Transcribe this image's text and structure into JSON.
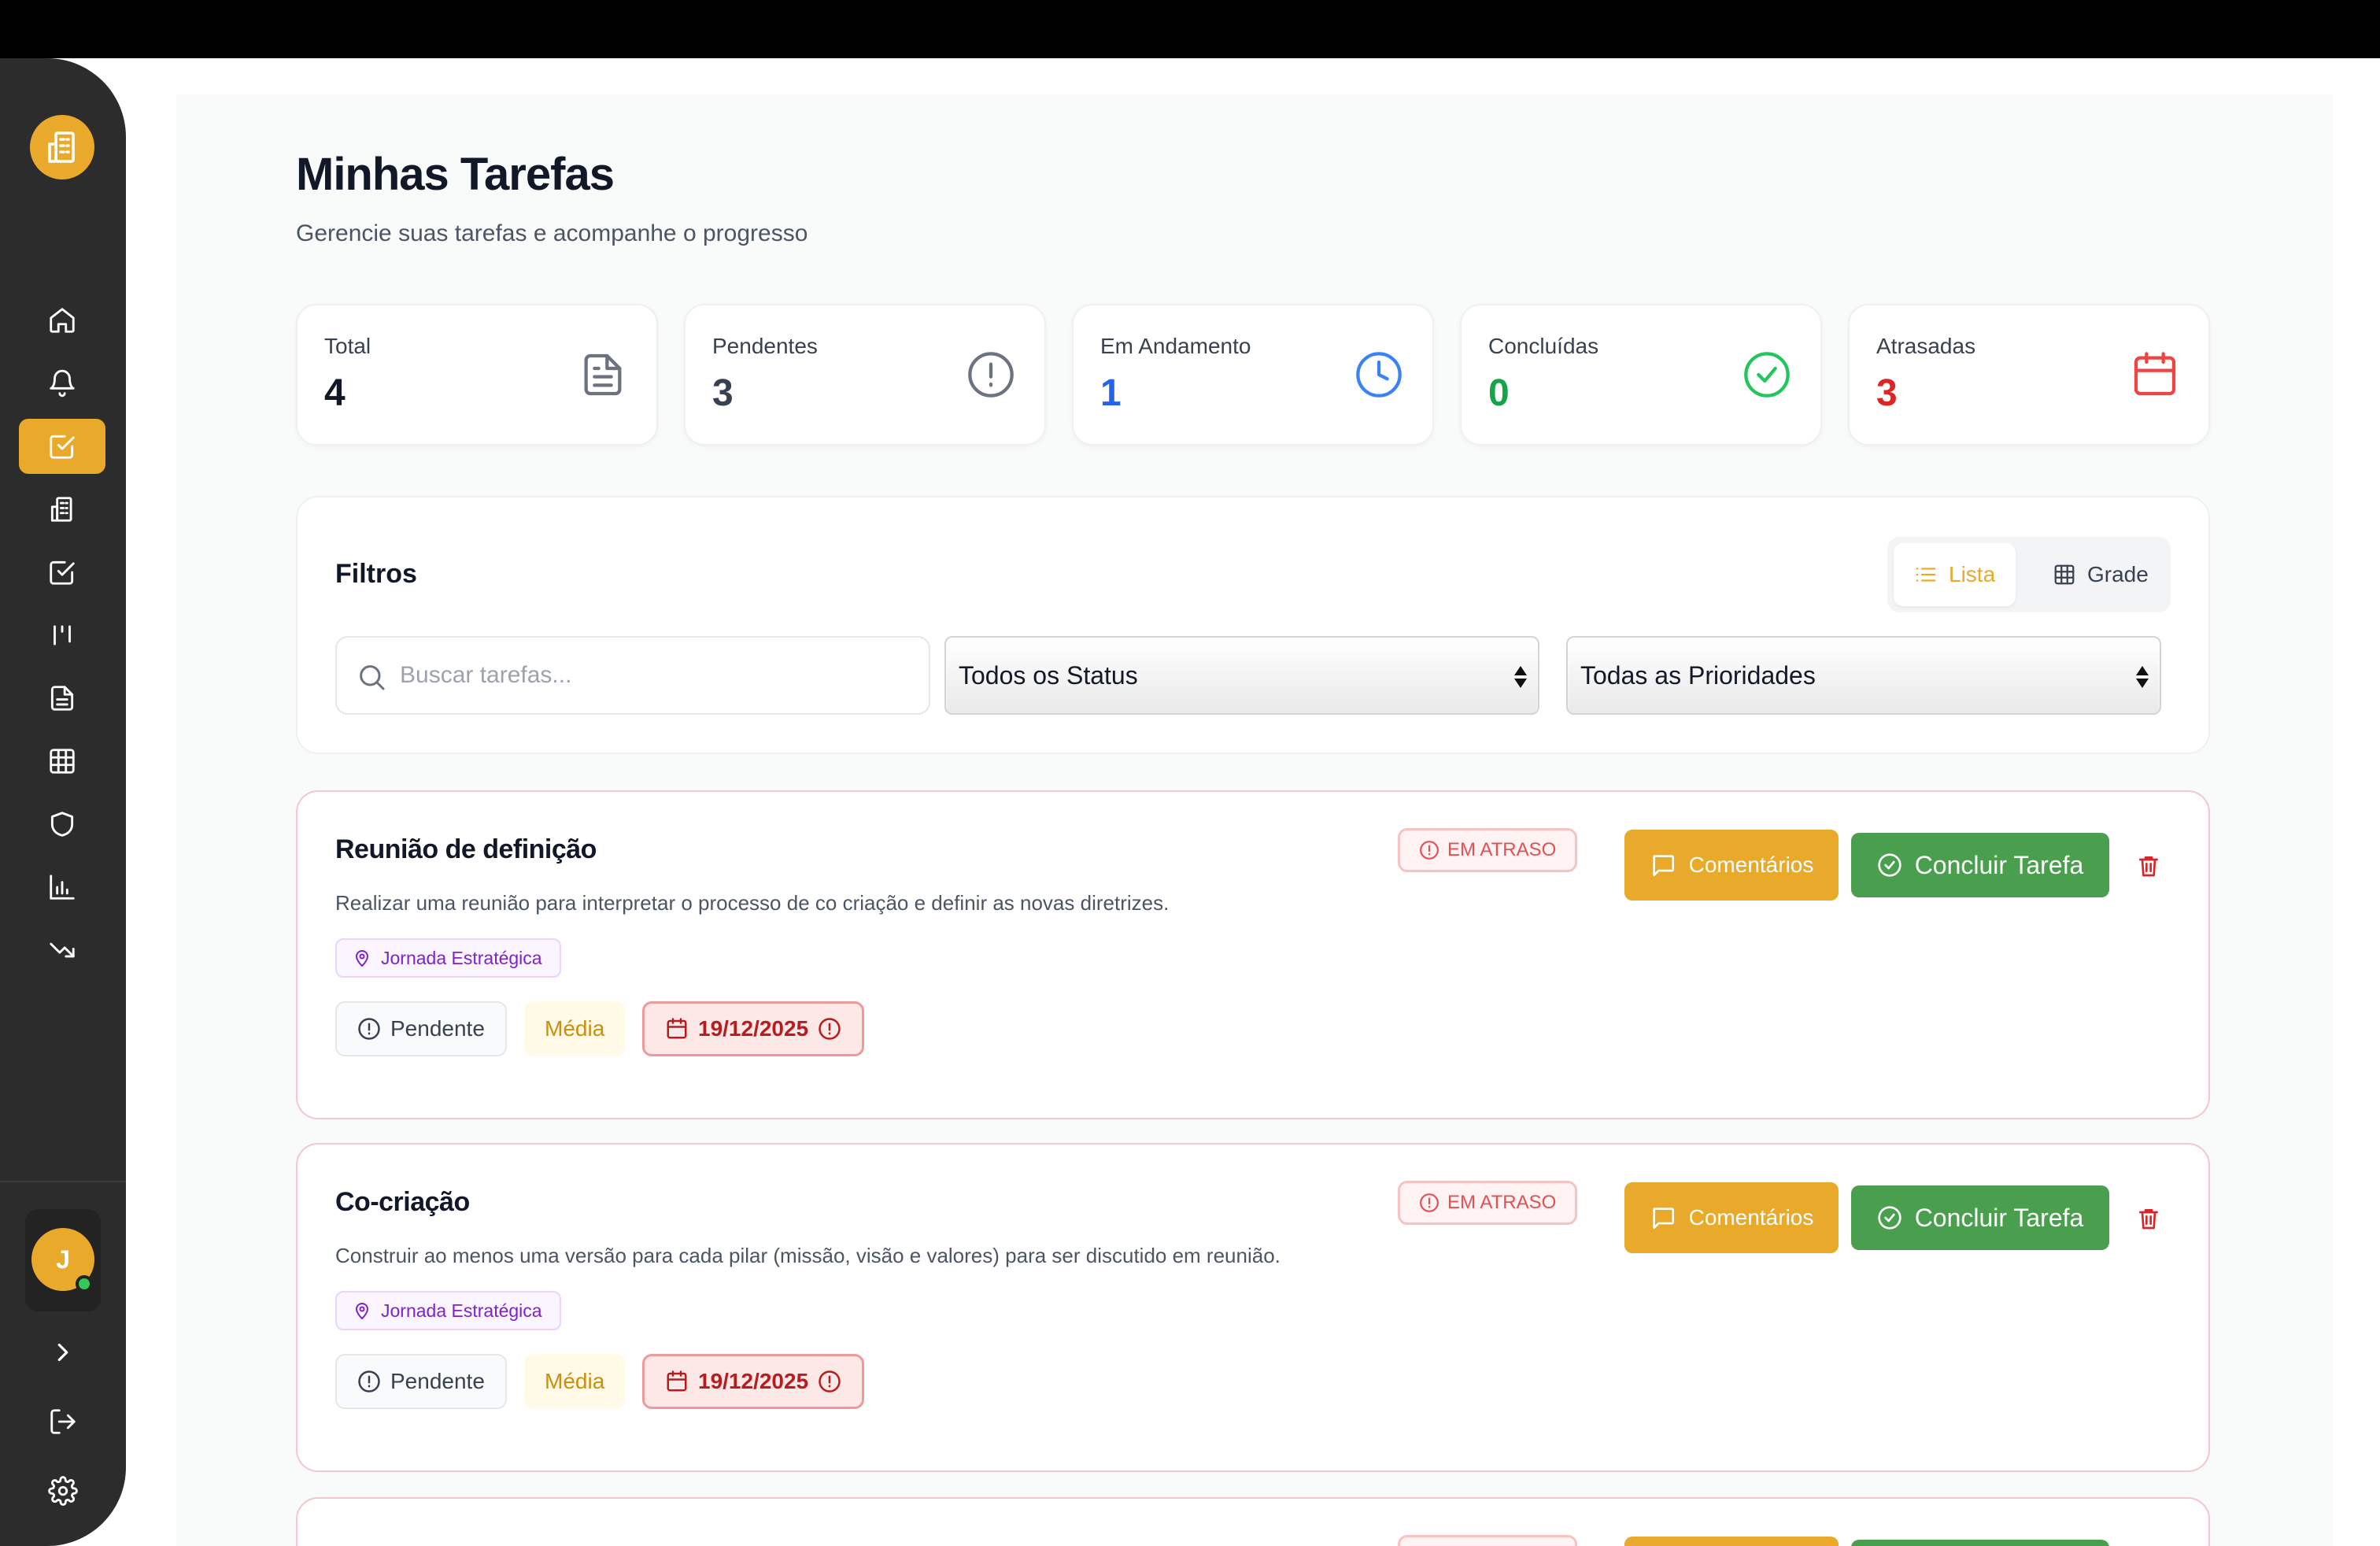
{
  "header": {
    "title": "Minhas Tarefas",
    "subtitle": "Gerencie suas tarefas e acompanhe o progresso"
  },
  "sidebar": {
    "items": [
      {
        "icon": "home-icon"
      },
      {
        "icon": "bell-icon"
      },
      {
        "icon": "task-check-icon",
        "active": true
      },
      {
        "icon": "building-icon"
      },
      {
        "icon": "checkbox-icon"
      },
      {
        "icon": "columns-icon"
      },
      {
        "icon": "document-icon"
      },
      {
        "icon": "grid-icon"
      },
      {
        "icon": "shield-icon"
      },
      {
        "icon": "bar-chart-icon"
      },
      {
        "icon": "trending-down-icon"
      }
    ],
    "user_initial": "J"
  },
  "stats": [
    {
      "label": "Total",
      "value": "4",
      "color": "#111827",
      "icon": "document-icon"
    },
    {
      "label": "Pendentes",
      "value": "3",
      "color": "#374151",
      "icon": "alert-circle-icon"
    },
    {
      "label": "Em Andamento",
      "value": "1",
      "color": "#2563eb",
      "icon": "clock-icon"
    },
    {
      "label": "Concluídas",
      "value": "0",
      "color": "#16a34a",
      "icon": "check-circle-icon"
    },
    {
      "label": "Atrasadas",
      "value": "3",
      "color": "#dc2626",
      "icon": "calendar-icon"
    }
  ],
  "filters": {
    "title": "Filtros",
    "view_list": "Lista",
    "view_grid": "Grade",
    "search_placeholder": "Buscar tarefas...",
    "status_selected": "Todos os Status",
    "priority_selected": "Todas as Prioridades"
  },
  "tasks": [
    {
      "title": "Reunião de definição",
      "description": "Realizar uma reunião para interpretar o processo de co criação e definir as novas diretrizes.",
      "project": "Jornada Estratégica",
      "status": "Pendente",
      "priority": "Média",
      "due_date": "19/12/2025",
      "badge": "EM ATRASO",
      "comments_label": "Comentários",
      "complete_label": "Concluir Tarefa"
    },
    {
      "title": "Co-criação",
      "description": "Construir ao menos uma versão para cada pilar (missão, visão e valores) para ser discutido em reunião.",
      "project": "Jornada Estratégica",
      "status": "Pendente",
      "priority": "Média",
      "due_date": "19/12/2025",
      "badge": "EM ATRASO",
      "comments_label": "Comentários",
      "complete_label": "Concluir Tarefa"
    }
  ],
  "colors": {
    "accent": "#e9aa2b",
    "success": "#4a9f4e",
    "danger": "#dc2626",
    "sidebar": "#2c2c2c"
  }
}
